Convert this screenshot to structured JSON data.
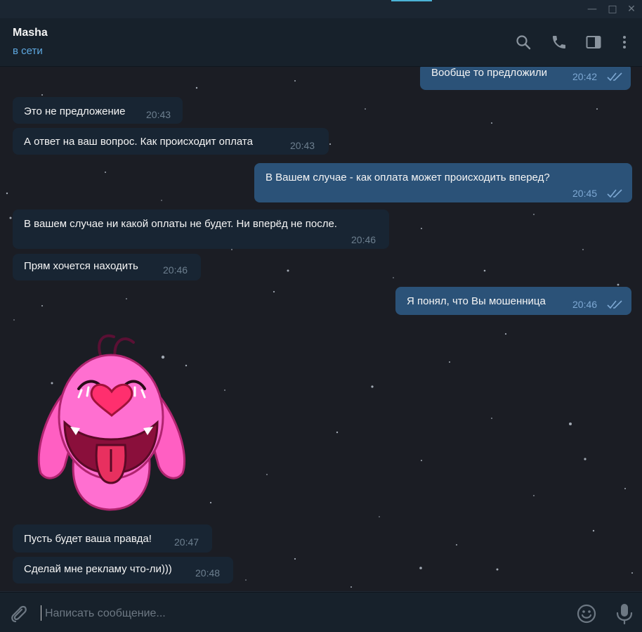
{
  "window": {
    "buttons": {
      "minimize": "—",
      "maximize": "□",
      "close": "✕"
    }
  },
  "header": {
    "name": "Masha",
    "status": "в сети",
    "icons": [
      "search-icon",
      "phone-icon",
      "sidebar-toggle-icon",
      "more-vertical-icon"
    ]
  },
  "messages": [
    {
      "dir": "out",
      "text": "Вообще то предложили",
      "time": "20:42",
      "read": true
    },
    {
      "dir": "in",
      "text": "Это не предложение",
      "time": "20:43"
    },
    {
      "dir": "in",
      "text": "А ответ на ваш вопрос. Как происходит оплата",
      "time": "20:43"
    },
    {
      "dir": "out",
      "text": "В Вашем случае - как оплата может происходить вперед?",
      "time": "20:45",
      "read": true
    },
    {
      "dir": "in",
      "text": "В вашем случае ни какой оплаты не будет. Ни вперёд не после.",
      "time": "20:46"
    },
    {
      "dir": "in",
      "text": "Прям хочется находить",
      "time": "20:46"
    },
    {
      "dir": "out",
      "text": "Я понял, что Вы мошенница",
      "time": "20:46",
      "read": true
    },
    {
      "dir": "in",
      "text": "Пусть будет ваша правда!",
      "time": "20:47"
    },
    {
      "dir": "in",
      "text": "Сделай мне рекламу что-ли)))",
      "time": "20:48"
    }
  ],
  "sticker": {
    "icon": "pink-bunny-sticker"
  },
  "composer": {
    "placeholder": "Написать сообщение...",
    "icons": [
      "paperclip-icon",
      "emoji-icon",
      "microphone-icon"
    ]
  },
  "colors": {
    "header_bg": "#17212b",
    "incoming_bubble": "#182533",
    "outgoing_bubble": "#2b5278",
    "accent": "#5ea8e0"
  }
}
